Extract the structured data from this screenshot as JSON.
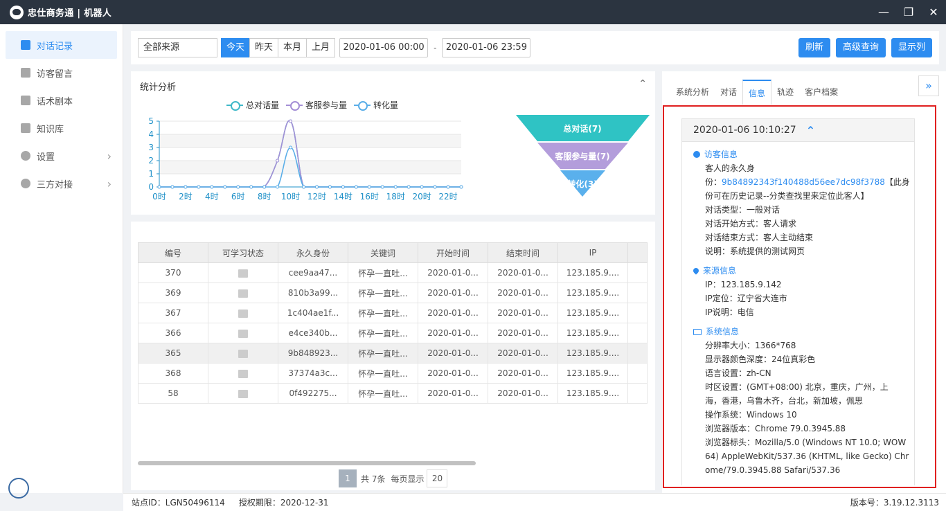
{
  "app": {
    "title": "忠仕商务通 | 机器人"
  },
  "sidebar": {
    "items": [
      {
        "label": "对话记录",
        "icon": "chat-record-icon",
        "active": true
      },
      {
        "label": "访客留言",
        "icon": "pencil-icon"
      },
      {
        "label": "话术剧本",
        "icon": "script-icon"
      },
      {
        "label": "知识库",
        "icon": "book-icon"
      },
      {
        "label": "设置",
        "icon": "gear-icon",
        "has_children": true
      },
      {
        "label": "三方对接",
        "icon": "integration-icon",
        "has_children": true
      }
    ]
  },
  "filter": {
    "source": "全部来源",
    "tabs": [
      "今天",
      "昨天",
      "本月",
      "上月"
    ],
    "active_tab": "今天",
    "start": "2020-01-06 00:00",
    "separator": "-",
    "end": "2020-01-06 23:59",
    "buttons": {
      "refresh": "刷新",
      "advanced": "高级查询",
      "columns": "显示列"
    }
  },
  "stats": {
    "title": "统计分析",
    "legend": [
      "总对话量",
      "客服参与量",
      "转化量"
    ],
    "funnel": [
      "总对话(7)",
      "客服参与量(7)",
      "转化(3)"
    ]
  },
  "chart_data": {
    "type": "line",
    "x": [
      "0时",
      "1时",
      "2时",
      "3时",
      "4时",
      "5时",
      "6时",
      "7时",
      "8时",
      "9时",
      "10时",
      "11时",
      "12时",
      "13时",
      "14时",
      "15时",
      "16时",
      "17时",
      "18时",
      "19时",
      "20时",
      "21时",
      "22时",
      "23时"
    ],
    "xticks": [
      "0时",
      "2时",
      "4时",
      "6时",
      "8时",
      "10时",
      "12时",
      "14时",
      "16时",
      "18时",
      "20时",
      "22时"
    ],
    "ylim": [
      0,
      5
    ],
    "yticks": [
      "0",
      "1",
      "2",
      "3",
      "4",
      "5"
    ],
    "series": [
      {
        "name": "总对话量",
        "color": "#3fb8c8",
        "values": [
          0,
          0,
          0,
          0,
          0,
          0,
          0,
          0,
          0,
          2,
          5,
          0,
          0,
          0,
          0,
          0,
          0,
          0,
          0,
          0,
          0,
          0,
          0,
          0
        ]
      },
      {
        "name": "客服参与量",
        "color": "#a48fd6",
        "values": [
          0,
          0,
          0,
          0,
          0,
          0,
          0,
          0,
          0,
          2,
          5,
          0,
          0,
          0,
          0,
          0,
          0,
          0,
          0,
          0,
          0,
          0,
          0,
          0
        ]
      },
      {
        "name": "转化量",
        "color": "#5aaee8",
        "values": [
          0,
          0,
          0,
          0,
          0,
          0,
          0,
          0,
          0,
          0,
          3,
          0,
          0,
          0,
          0,
          0,
          0,
          0,
          0,
          0,
          0,
          0,
          0,
          0
        ]
      }
    ],
    "grid": true
  },
  "table": {
    "columns": [
      "编号",
      "可学习状态",
      "永久身份",
      "关键词",
      "开始时间",
      "结束时间",
      "IP"
    ],
    "rows": [
      [
        "370",
        "",
        "cee9aa47...",
        "怀孕一直吐...",
        "2020-01-0...",
        "2020-01-0...",
        "123.185.9...."
      ],
      [
        "369",
        "",
        "810b3a99...",
        "怀孕一直吐...",
        "2020-01-0...",
        "2020-01-0...",
        "123.185.9...."
      ],
      [
        "367",
        "",
        "1c404ae1f...",
        "怀孕一直吐...",
        "2020-01-0...",
        "2020-01-0...",
        "123.185.9...."
      ],
      [
        "366",
        "",
        "e4ce340b...",
        "怀孕一直吐...",
        "2020-01-0...",
        "2020-01-0...",
        "123.185.9...."
      ],
      [
        "365",
        "",
        "9b848923...",
        "怀孕一直吐...",
        "2020-01-0...",
        "2020-01-0...",
        "123.185.9...."
      ],
      [
        "368",
        "",
        "37374a3c...",
        "怀孕一直吐...",
        "2020-01-0...",
        "2020-01-0...",
        "123.185.9...."
      ],
      [
        "58",
        "",
        "0f492275...",
        "怀孕一直吐...",
        "2020-01-0...",
        "2020-01-0...",
        "123.185.9...."
      ]
    ],
    "highlighted_row": 4,
    "pager": {
      "current": "1",
      "total": "共 7条",
      "per_page_label": "每页显示",
      "per_page": "20"
    }
  },
  "detail": {
    "tabs": [
      "系统分析",
      "对话",
      "信息",
      "轨迹",
      "客户档案"
    ],
    "active_tab": "信息",
    "timestamp": "2020-01-06 10:10:27",
    "visitor": {
      "title": "访客信息",
      "l1": "客人的永久身",
      "l2_prefix": "份：",
      "l2_link": "9b84892343f140488d56ee7dc98f3788",
      "l2_suffix": "【此身",
      "l3": "份可在历史记录--分类查找里来定位此客人】",
      "l4": "对话类型：一般对话",
      "l5": "对话开始方式：客人请求",
      "l6": "对话结束方式：客人主动结束",
      "l7": "说明：系统提供的测试网页"
    },
    "source": {
      "title": "来源信息",
      "l1": "IP：123.185.9.142",
      "l2": "IP定位：辽宁省大连市",
      "l3": "IP说明：电信"
    },
    "system": {
      "title": "系统信息",
      "l1": "分辨率大小：1366*768",
      "l2": "显示器颜色深度：24位真彩色",
      "l3": "语言设置：zh-CN",
      "l4": "时区设置：(GMT+08:00) 北京，重庆，广州，上",
      "l5": "海，香港，乌鲁木齐，台北，新加坡，佩思",
      "l6": "操作系统：Windows 10",
      "l7": "浏览器版本：Chrome 79.0.3945.88",
      "l8": "浏览器标头：Mozilla/5.0 (Windows NT 10.0; WOW",
      "l9": "64) AppleWebKit/537.36 (KHTML, like Gecko) Chr",
      "l10": "ome/79.0.3945.88 Safari/537.36"
    }
  },
  "status": {
    "site": "站点ID：LGN50496114",
    "license": "授权期限：2020-12-31",
    "version": "版本号：3.19.12.3113"
  }
}
